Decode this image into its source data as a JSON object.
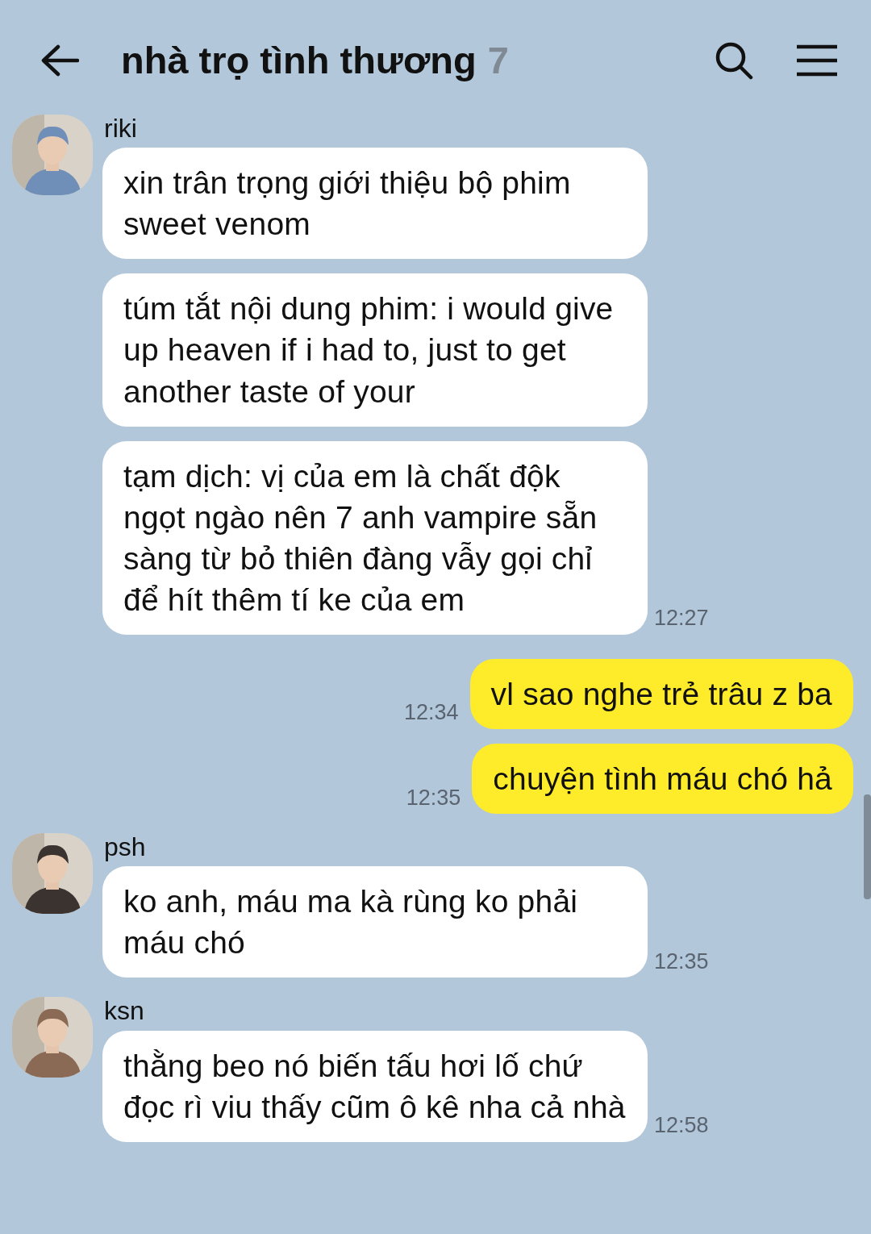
{
  "header": {
    "title": "nhà trọ tình thương",
    "member_count": "7"
  },
  "groups": [
    {
      "kind": "received",
      "sender": "riki",
      "avatar": {
        "kind": "picture"
      },
      "bubbles": [
        {
          "text": "xin trân trọng giới thiệu bộ phim sweet venom"
        },
        {
          "text": "túm tắt nội dung phim: i would give up heaven if i had to, just to get another taste of your"
        },
        {
          "text": "tạm dịch: vị của em là chất độk ngọt ngào nên 7 anh vampire sẵn sàng từ bỏ thiên đàng vẫy gọi chỉ để hít thêm tí ke của em",
          "time": "12:27"
        }
      ]
    },
    {
      "kind": "sent",
      "bubbles": [
        {
          "text": "vl sao nghe trẻ trâu z ba",
          "time": "12:34"
        },
        {
          "text": "chuyện tình máu chó hả",
          "time": "12:35"
        }
      ]
    },
    {
      "kind": "received",
      "sender": "psh",
      "avatar": {
        "kind": "picture"
      },
      "bubbles": [
        {
          "text": "ko anh, máu ma kà rùng ko phải máu chó",
          "time": "12:35"
        }
      ]
    },
    {
      "kind": "received",
      "sender": "ksn",
      "avatar": {
        "kind": "picture"
      },
      "bubbles": [
        {
          "text": "thằng beo nó biến tấu hơi lố chứ đọc rì viu thấy cũm ô kê nha cả nhà",
          "time": "12:58"
        }
      ]
    }
  ]
}
